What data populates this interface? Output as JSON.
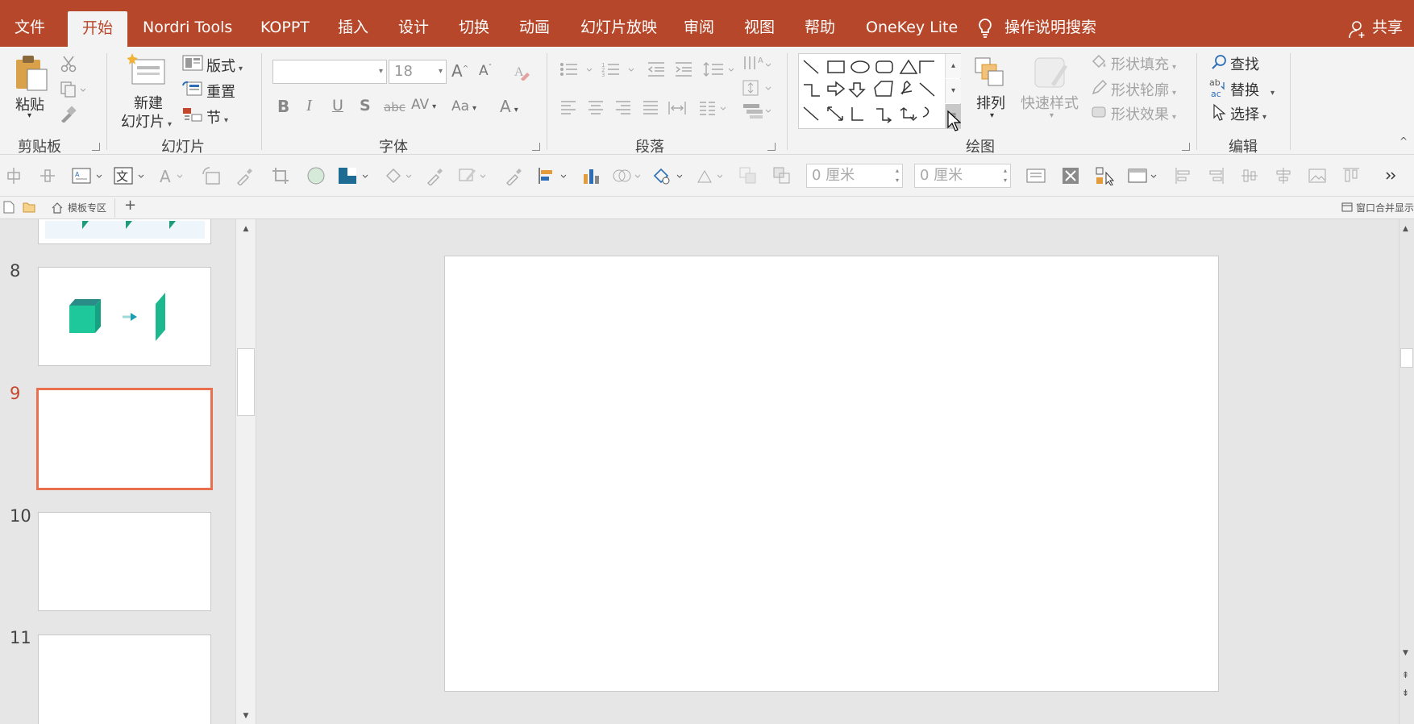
{
  "menu": {
    "items": [
      "文件",
      "开始",
      "Nordri Tools",
      "KOPPT",
      "插入",
      "设计",
      "切换",
      "动画",
      "幻灯片放映",
      "审阅",
      "视图",
      "帮助",
      "OneKey Lite"
    ],
    "active": "开始",
    "search_label": "操作说明搜索",
    "share_label": "共享"
  },
  "ribbon": {
    "clipboard": {
      "paste": "粘贴",
      "group": "剪贴板"
    },
    "slides": {
      "new_line1": "新建",
      "new_line2": "幻灯片",
      "layout": "版式",
      "reset": "重置",
      "section": "节",
      "group": "幻灯片"
    },
    "font": {
      "name_value": "",
      "size_value": "18",
      "group": "字体"
    },
    "paragraph": {
      "group": "段落"
    },
    "drawing": {
      "arrange": "排列",
      "quick_styles": "快速样式",
      "fill": "形状填充",
      "outline": "形状轮廓",
      "effects": "形状效果",
      "group": "绘图"
    },
    "editing": {
      "find": "查找",
      "replace": "替换",
      "select": "选择",
      "group": "编辑"
    }
  },
  "toolbar2": {
    "width_value": "0 厘米",
    "height_value": "0 厘米"
  },
  "tabs": {
    "template_tab": "模板专区",
    "merge_windows": "窗口合并显示"
  },
  "slides": [
    {
      "number": "8",
      "has_cube": true
    },
    {
      "number": "9",
      "selected": true
    },
    {
      "number": "10"
    },
    {
      "number": "11"
    }
  ],
  "colors": {
    "accent": "#b7472a",
    "selected_border": "#e9704f",
    "cube_green": "#1fc89a"
  }
}
